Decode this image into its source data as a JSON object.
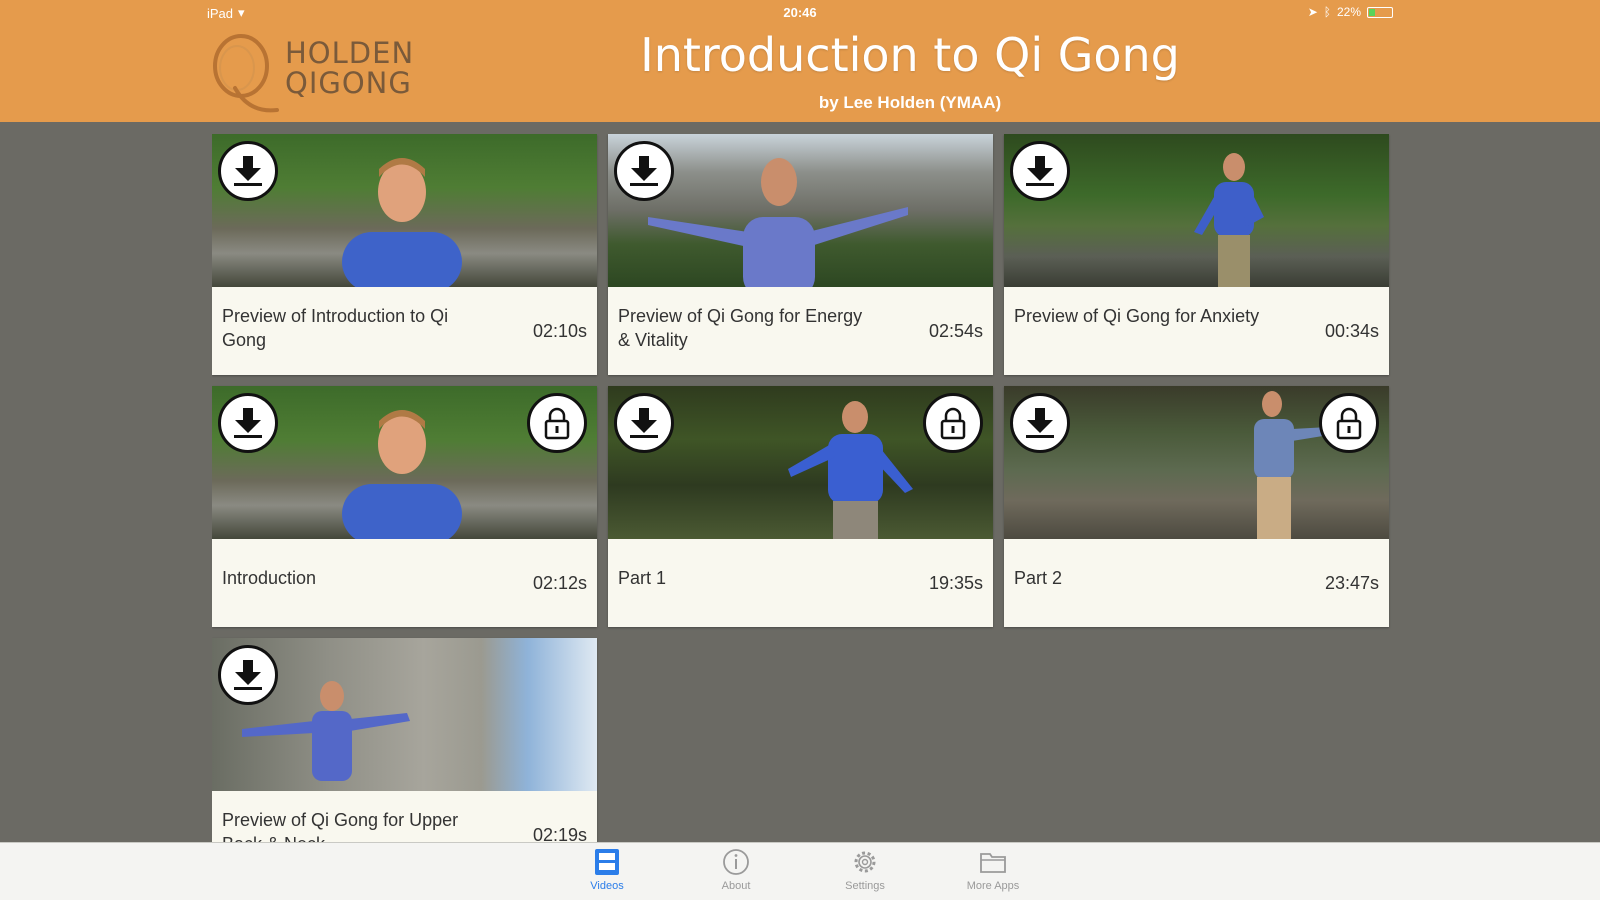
{
  "status_bar": {
    "device": "iPad",
    "time": "20:46",
    "battery": "22%"
  },
  "header": {
    "logo_line1": "HOLDEN",
    "logo_line2": "QIGONG",
    "title": "Introduction to Qi Gong",
    "subtitle": "by Lee Holden (YMAA)"
  },
  "videos": [
    {
      "title": "Preview of Introduction to Qi Gong",
      "duration": "02:10s",
      "locked": false
    },
    {
      "title": "Preview of Qi Gong for Energy & Vitality",
      "duration": "02:54s",
      "locked": false
    },
    {
      "title": "Preview of Qi Gong for Anxiety",
      "duration": "00:34s",
      "locked": false
    },
    {
      "title": "Introduction",
      "duration": "02:12s",
      "locked": true
    },
    {
      "title": "Part 1",
      "duration": "19:35s",
      "locked": true
    },
    {
      "title": "Part 2",
      "duration": "23:47s",
      "locked": true
    },
    {
      "title": "Preview of Qi Gong for Upper Back & Neck",
      "duration": "02:19s",
      "locked": false
    }
  ],
  "tabbar": {
    "tabs": [
      {
        "label": "Videos",
        "icon": "video-list-icon",
        "active": true
      },
      {
        "label": "About",
        "icon": "info-icon",
        "active": false
      },
      {
        "label": "Settings",
        "icon": "gear-icon",
        "active": false
      },
      {
        "label": "More Apps",
        "icon": "folder-icon",
        "active": false
      }
    ]
  },
  "colors": {
    "header": "#e59b4c",
    "background": "#6b6a64",
    "card": "#f9f8ef",
    "active_tab": "#2b7de9"
  }
}
